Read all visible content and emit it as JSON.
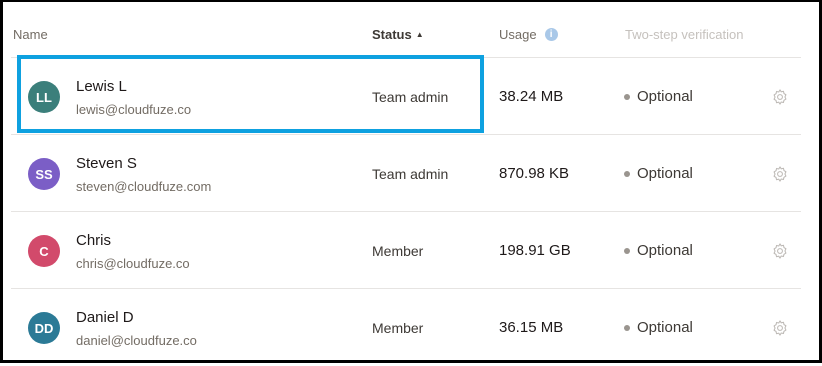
{
  "columns": {
    "name": "Name",
    "status": "Status",
    "status_sort_icon": "sort-ascending-icon",
    "usage": "Usage",
    "usage_info_icon": "info-icon",
    "two_step": "Two-step verification"
  },
  "members": [
    {
      "initials": "LL",
      "avatar_color": "#3b7f7b",
      "name": "Lewis L",
      "email": "lewis@cloudfuze.co",
      "status": "Team admin",
      "usage": "38.24 MB",
      "two_step": "Optional"
    },
    {
      "initials": "SS",
      "avatar_color": "#7b5ec6",
      "name": "Steven S",
      "email": "steven@cloudfuze.com",
      "status": "Team admin",
      "usage": "870.98 KB",
      "two_step": "Optional"
    },
    {
      "initials": "C",
      "avatar_color": "#d24a6b",
      "name": "Chris",
      "email": "chris@cloudfuze.co",
      "status": "Member",
      "usage": "198.91 GB",
      "two_step": "Optional"
    },
    {
      "initials": "DD",
      "avatar_color": "#2b7a96",
      "name": "Daniel D",
      "email": "daniel@cloudfuze.co",
      "status": "Member",
      "usage": "36.15 MB",
      "two_step": "Optional"
    }
  ],
  "highlight_color": "#0ea1e0",
  "settings_icon": "gear-icon"
}
